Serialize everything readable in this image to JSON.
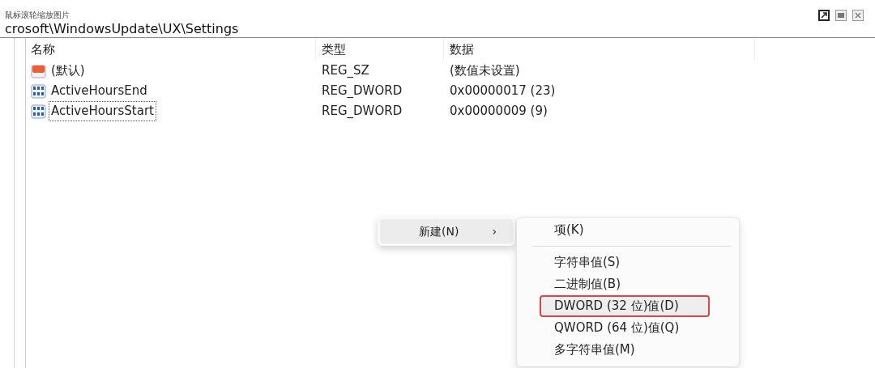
{
  "window": {
    "hint": "鼠标滚轮缩放图片",
    "buttons": [
      {
        "kind": "restore",
        "selected": true
      },
      {
        "kind": "maximize",
        "selected": false
      },
      {
        "kind": "close",
        "selected": false
      }
    ]
  },
  "address": "crosoft\\WindowsUpdate\\UX\\Settings",
  "table": {
    "columns": [
      "名称",
      "类型",
      "数据"
    ],
    "rows": [
      {
        "kind": "string",
        "name": "(默认)",
        "type": "REG_SZ",
        "data": "(数值未设置)",
        "selected": false
      },
      {
        "kind": "dword",
        "name": "ActiveHoursEnd",
        "type": "REG_DWORD",
        "data": "0x00000017 (23)",
        "selected": false
      },
      {
        "kind": "dword",
        "name": "ActiveHoursStart",
        "type": "REG_DWORD",
        "data": "0x00000009 (9)",
        "selected": true
      }
    ]
  },
  "context_menu": {
    "items": [
      {
        "label": "新建(N)",
        "arrow": "›",
        "selected": true
      }
    ]
  },
  "submenu": {
    "items": [
      {
        "kind": "item",
        "label": "项(K)",
        "selected": false,
        "annotated": false
      },
      {
        "kind": "separator"
      },
      {
        "kind": "item",
        "label": "字符串值(S)",
        "selected": false,
        "annotated": false
      },
      {
        "kind": "item",
        "label": "二进制值(B)",
        "selected": false,
        "annotated": false
      },
      {
        "kind": "item",
        "label": "DWORD (32 位)值(D)",
        "selected": true,
        "annotated": true
      },
      {
        "kind": "item",
        "label": "QWORD (64 位)值(Q)",
        "selected": false,
        "annotated": false
      },
      {
        "kind": "item",
        "label": "多字符串值(M)",
        "selected": false,
        "annotated": false
      }
    ]
  }
}
